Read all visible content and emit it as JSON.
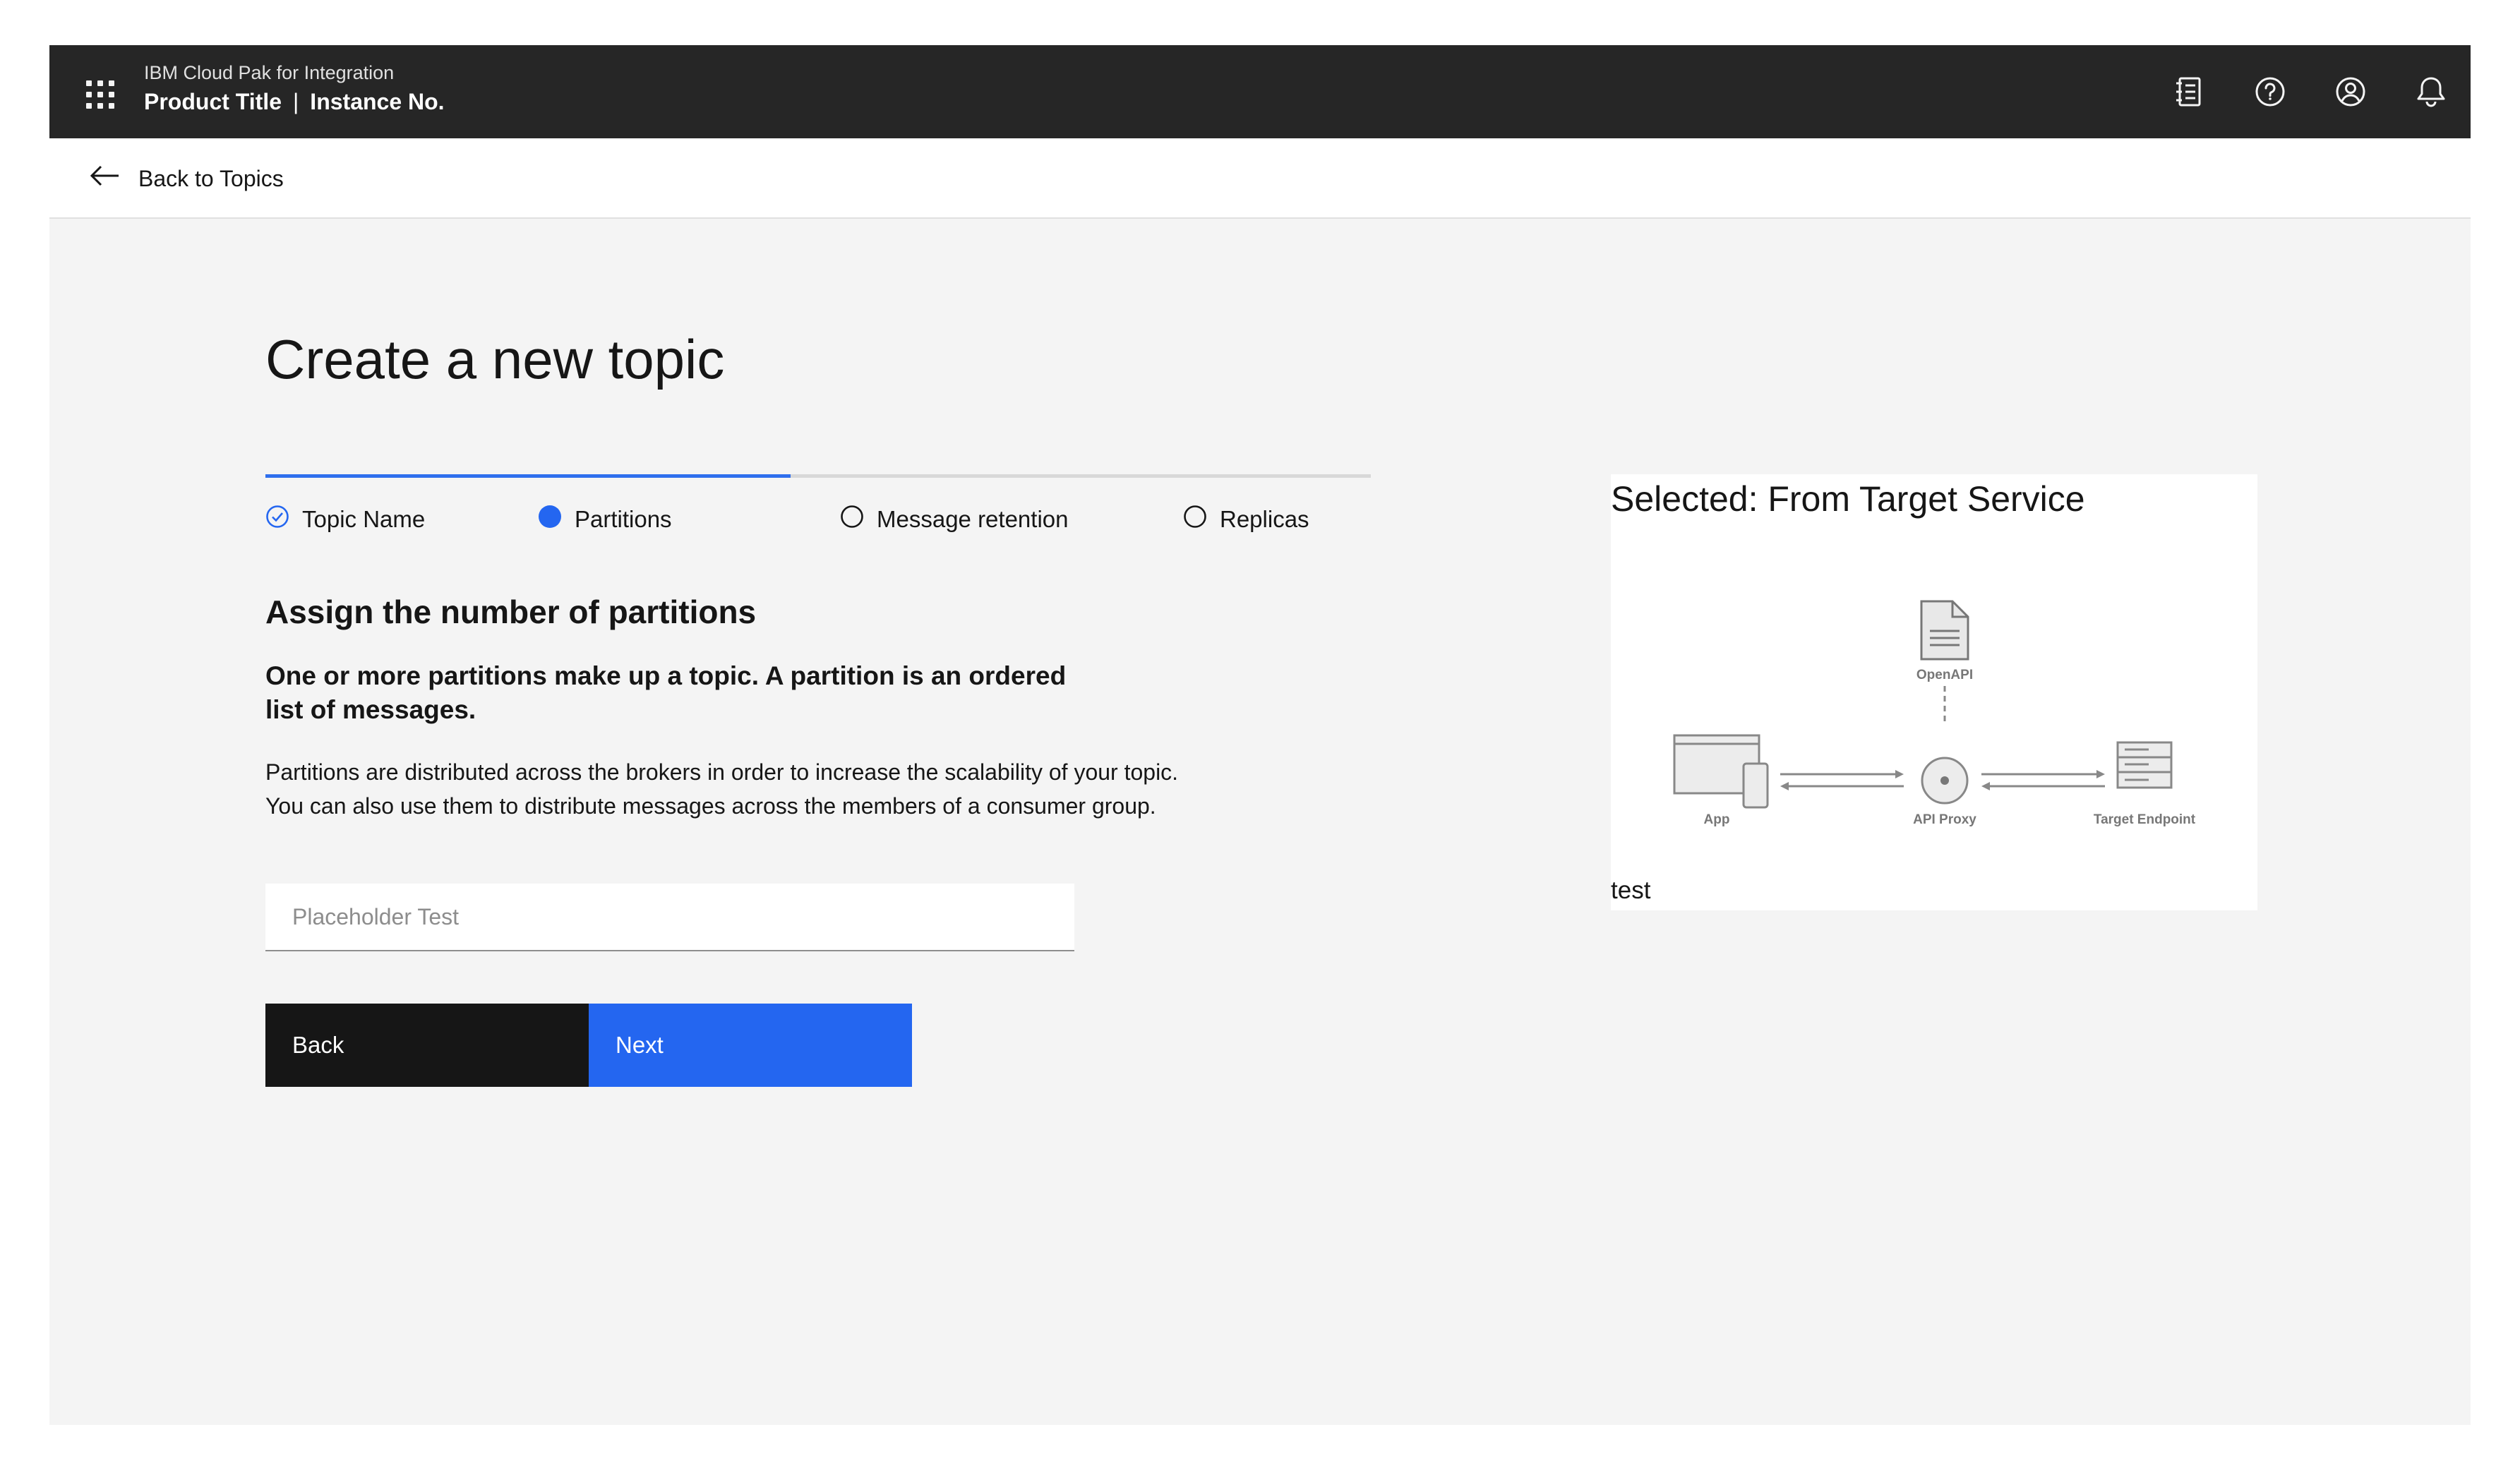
{
  "header": {
    "product_family": "IBM Cloud Pak for Integration",
    "product_title": "Product Title",
    "separator": "|",
    "instance": "Instance No.",
    "icons": [
      "app-switcher-icon",
      "notebook-icon",
      "help-icon",
      "user-icon",
      "notification-icon"
    ]
  },
  "nav": {
    "back_label": "Back to Topics"
  },
  "page": {
    "title": "Create a new topic"
  },
  "progress": {
    "current_step": 2,
    "steps": [
      {
        "label": "Topic Name",
        "state": "complete"
      },
      {
        "label": "Partitions",
        "state": "current"
      },
      {
        "label": "Message retention",
        "state": "incomplete"
      },
      {
        "label": "Replicas",
        "state": "incomplete"
      }
    ]
  },
  "form": {
    "heading": "Assign the number of partitions",
    "lead": "One or more partitions make up a topic. A partition is an ordered list of messages.",
    "description": "Partitions are distributed across the brokers in order to increase the scalability of your topic. You can also use them to distribute messages across the members of a consumer group.",
    "input_value": "",
    "input_placeholder": "Placeholder Test",
    "back_label": "Back",
    "next_label": "Next"
  },
  "card": {
    "title": "Selected: From Target Service",
    "caption": "test",
    "diagram": {
      "openapi_label": "OpenAPI",
      "app_label": "App",
      "proxy_label": "API Proxy",
      "target_label": "Target Endpoint"
    }
  },
  "colors": {
    "header_bg": "#262626",
    "accent": "#2466f0",
    "page_bg": "#f4f4f4"
  }
}
